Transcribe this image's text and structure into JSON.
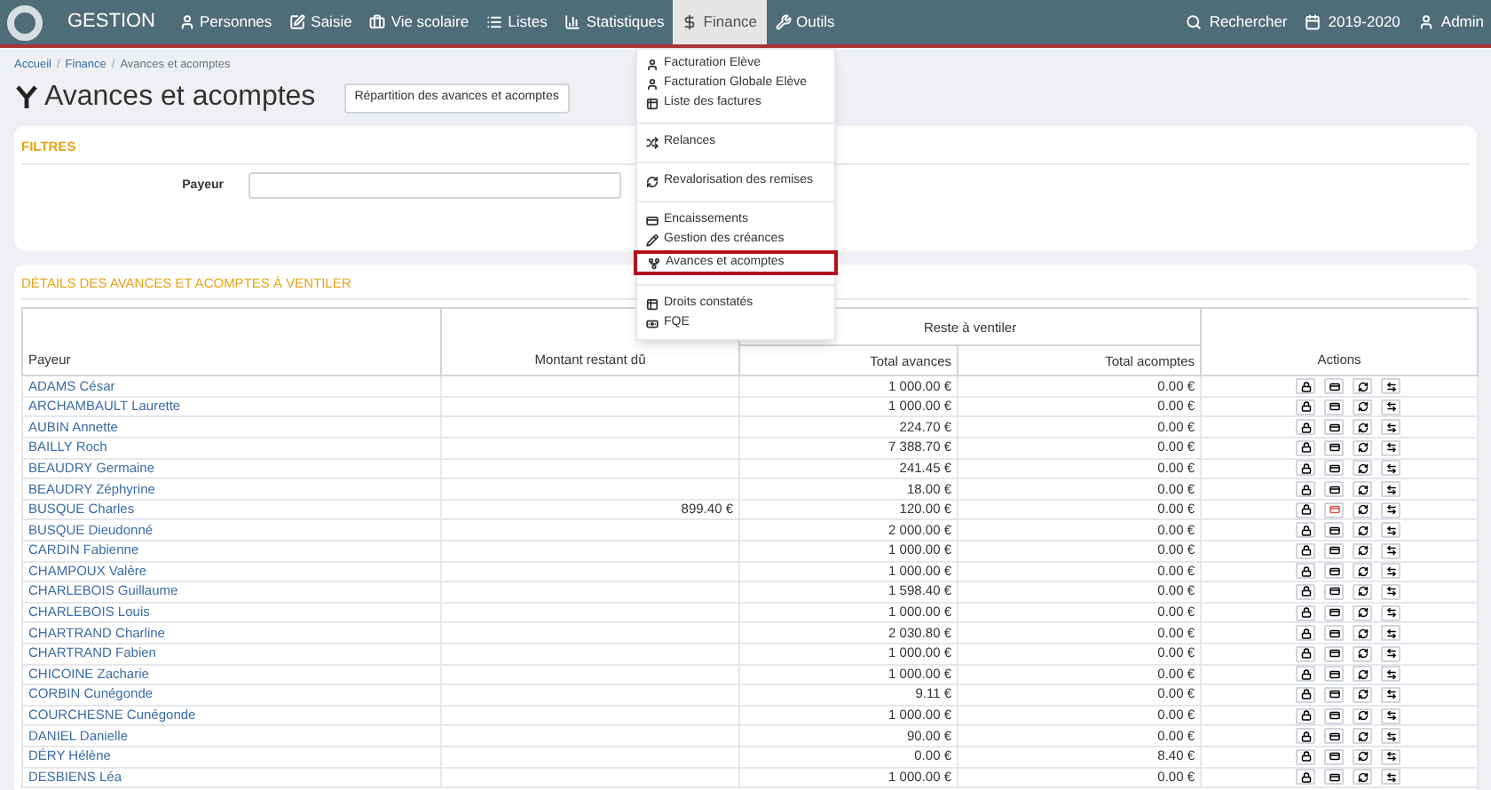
{
  "navbar": {
    "brand": "GESTION",
    "items": [
      {
        "label": "Personnes",
        "selected": false
      },
      {
        "label": "Saisie",
        "selected": false
      },
      {
        "label": "Vie scolaire",
        "selected": false
      },
      {
        "label": "Listes",
        "selected": false
      },
      {
        "label": "Statistiques",
        "selected": false
      },
      {
        "label": "Finance",
        "selected": true
      },
      {
        "label": "Outils",
        "selected": false
      }
    ],
    "right": [
      "Rechercher",
      "2019-2020",
      "Admin"
    ]
  },
  "breadcrumb": [
    "Accueil",
    "Finance",
    "Avances et acomptes"
  ],
  "breadcrumb_separator": "/",
  "title": "Avances et acomptes",
  "title_button": "Répartition des avances et acomptes",
  "filters": {
    "heading": "FILTRES",
    "label": "Payeur"
  },
  "dropdown": {
    "groups": [
      [
        {
          "label": "Facturation Elève",
          "selected": false
        },
        {
          "label": "Facturation Globale Elève",
          "selected": false
        },
        {
          "label": "Liste des factures",
          "selected": false
        }
      ],
      [
        {
          "label": "Relances",
          "selected": false
        }
      ],
      [
        {
          "label": "Revalorisation des remises",
          "selected": false
        }
      ],
      [
        {
          "label": "Encaissements",
          "selected": false
        },
        {
          "label": "Gestion des créances",
          "selected": false
        },
        {
          "label": "Avances et acomptes",
          "selected": true
        }
      ],
      [
        {
          "label": "Droits constatés",
          "selected": false
        },
        {
          "label": "FQE",
          "selected": false
        }
      ]
    ]
  },
  "details": {
    "heading": "DÉTAILS DES AVANCES ET ACOMPTES À VENTILER",
    "columns": {
      "payer": "Payeur",
      "due": "Montant restant dû",
      "group": "Reste à ventiler",
      "advances": "Total avances",
      "deposits": "Total acomptes",
      "actions": "Actions"
    },
    "rows": [
      {
        "name": "ADAMS César",
        "due": "",
        "advances": "1 000.00 €",
        "deposits": "0.00 €",
        "flagged": false
      },
      {
        "name": "ARCHAMBAULT Laurette",
        "due": "",
        "advances": "1 000.00 €",
        "deposits": "0.00 €",
        "flagged": false
      },
      {
        "name": "AUBIN Annette",
        "due": "",
        "advances": "224.70 €",
        "deposits": "0.00 €",
        "flagged": false
      },
      {
        "name": "BAILLY Roch",
        "due": "",
        "advances": "7 388.70 €",
        "deposits": "0.00 €",
        "flagged": false
      },
      {
        "name": "BEAUDRY Germaine",
        "due": "",
        "advances": "241.45 €",
        "deposits": "0.00 €",
        "flagged": false
      },
      {
        "name": "BEAUDRY Zéphyrine",
        "due": "",
        "advances": "18.00 €",
        "deposits": "0.00 €",
        "flagged": false
      },
      {
        "name": "BUSQUE Charles",
        "due": "899.40 €",
        "advances": "120.00 €",
        "deposits": "0.00 €",
        "flagged": true
      },
      {
        "name": "BUSQUE Dieudonné",
        "due": "",
        "advances": "2 000.00 €",
        "deposits": "0.00 €",
        "flagged": false
      },
      {
        "name": "CARDIN Fabienne",
        "due": "",
        "advances": "1 000.00 €",
        "deposits": "0.00 €",
        "flagged": false
      },
      {
        "name": "CHAMPOUX Valère",
        "due": "",
        "advances": "1 000.00 €",
        "deposits": "0.00 €",
        "flagged": false
      },
      {
        "name": "CHARLEBOIS Guillaume",
        "due": "",
        "advances": "1 598.40 €",
        "deposits": "0.00 €",
        "flagged": false
      },
      {
        "name": "CHARLEBOIS Louis",
        "due": "",
        "advances": "1 000.00 €",
        "deposits": "0.00 €",
        "flagged": false
      },
      {
        "name": "CHARTRAND Charline",
        "due": "",
        "advances": "2 030.80 €",
        "deposits": "0.00 €",
        "flagged": false
      },
      {
        "name": "CHARTRAND Fabien",
        "due": "",
        "advances": "1 000.00 €",
        "deposits": "0.00 €",
        "flagged": false
      },
      {
        "name": "CHICOINE Zacharie",
        "due": "",
        "advances": "1 000.00 €",
        "deposits": "0.00 €",
        "flagged": false
      },
      {
        "name": "CORBIN Cunégonde",
        "due": "",
        "advances": "9.11 €",
        "deposits": "0.00 €",
        "flagged": false
      },
      {
        "name": "COURCHESNE Cunégonde",
        "due": "",
        "advances": "1 000.00 €",
        "deposits": "0.00 €",
        "flagged": false
      },
      {
        "name": "DANIEL Danielle",
        "due": "",
        "advances": "90.00 €",
        "deposits": "0.00 €",
        "flagged": false
      },
      {
        "name": "DÉRY Hélène",
        "due": "",
        "advances": "0.00 €",
        "deposits": "8.40 €",
        "flagged": false
      },
      {
        "name": "DESBIENS Léa",
        "due": "",
        "advances": "1 000.00 €",
        "deposits": "0.00 €",
        "flagged": false
      }
    ]
  }
}
